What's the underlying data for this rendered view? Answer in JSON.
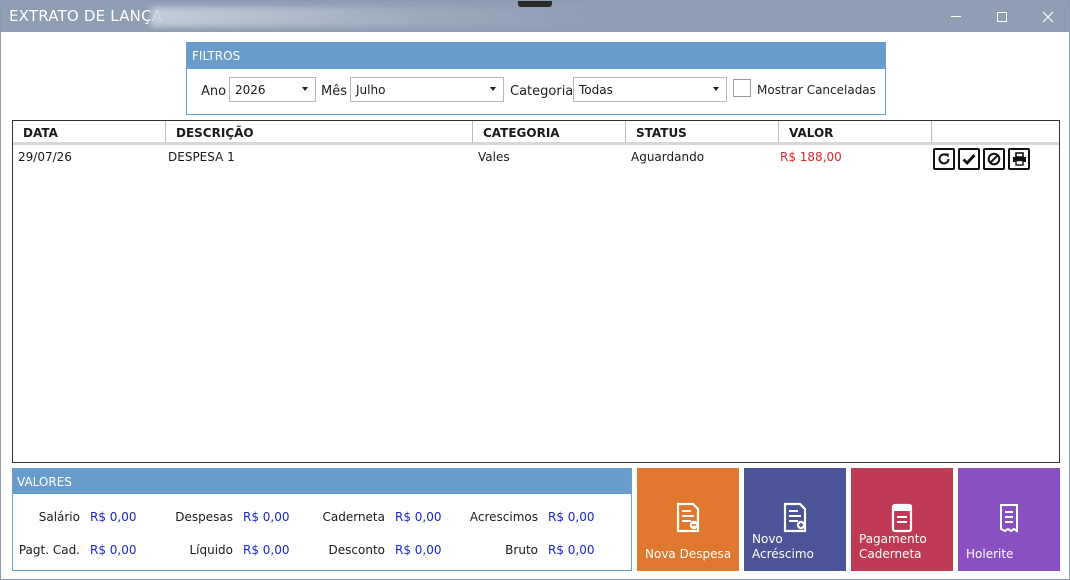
{
  "window": {
    "title": "EXTRATO DE LANÇA",
    "minimize_icon": "minimize-icon",
    "maximize_icon": "maximize-icon",
    "close_icon": "close-icon"
  },
  "filters": {
    "heading": "FILTROS",
    "ano_label": "Ano",
    "ano_value": "2026",
    "mes_label": "Mês",
    "mes_value": "Julho",
    "categoria_label": "Categoria",
    "categoria_value": "Todas",
    "mostrar_canceladas_label": "Mostrar Canceladas",
    "mostrar_canceladas_checked": false
  },
  "grid": {
    "columns": [
      "DATA",
      "DESCRIÇÃO",
      "CATEGORIA",
      "STATUS",
      "VALOR"
    ],
    "rows": [
      {
        "data": "29/07/26",
        "descricao": "DESPESA 1",
        "categoria": "Vales",
        "status": "Aguardando",
        "valor": "R$ 188,00",
        "valor_color": "#e02828",
        "actions": [
          "refresh-icon",
          "check-icon",
          "cancel-icon",
          "print-icon"
        ]
      }
    ]
  },
  "valores": {
    "heading": "VALORES",
    "salario_label": "Salário",
    "salario_value": "R$ 0,00",
    "despesas_label": "Despesas",
    "despesas_value": "R$ 0,00",
    "caderneta_label": "Caderneta",
    "caderneta_value": "R$ 0,00",
    "acrescimos_label": "Acrescimos",
    "acrescimos_value": "R$ 0,00",
    "pagt_cad_label": "Pagt. Cad.",
    "pagt_cad_value": "R$ 0,00",
    "liquido_label": "Líquido",
    "liquido_value": "R$ 0,00",
    "desconto_label": "Desconto",
    "desconto_value": "R$ 0,00",
    "bruto_label": "Bruto",
    "bruto_value": "R$ 0,00",
    "value_color": "#1a28c8"
  },
  "tiles": {
    "nova_despesa": {
      "line1": "Nova Despesa",
      "line2": "",
      "color": "#e0782f",
      "icon": "expense-document-icon"
    },
    "novo_acrescimo": {
      "line1": "Novo",
      "line2": "Acréscimo",
      "color": "#4a5497",
      "icon": "addition-document-icon"
    },
    "pagamento_caderneta": {
      "line1": "Pagamento",
      "line2": "Caderneta",
      "color": "#bf3a55",
      "icon": "notebook-icon"
    },
    "holerite": {
      "line1": "Holerite",
      "line2": "",
      "color": "#8a4fc0",
      "icon": "receipt-icon"
    }
  }
}
